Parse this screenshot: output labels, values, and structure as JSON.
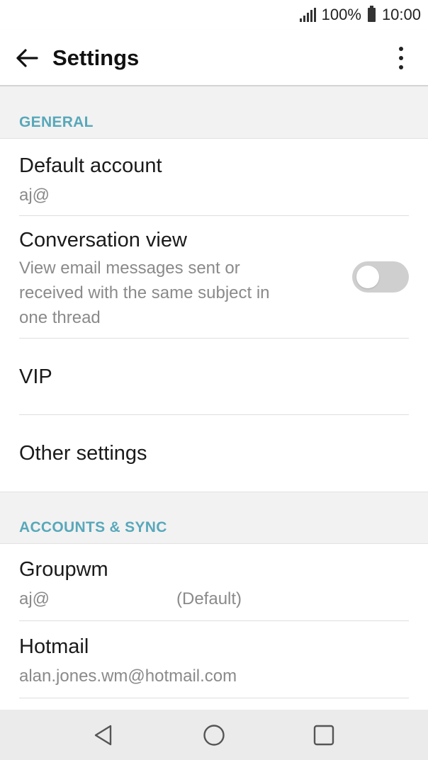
{
  "status_bar": {
    "battery_percent": "100%",
    "time": "10:00"
  },
  "app_bar": {
    "title": "Settings",
    "back_icon": "arrow-left-icon",
    "menu_icon": "more-vertical-icon"
  },
  "general": {
    "header": "GENERAL",
    "default_account": {
      "title": "Default account",
      "value": "aj@"
    },
    "conversation_view": {
      "title": "Conversation view",
      "description_lines": [
        "View email messages sent or",
        "received with the same subject in",
        "one thread"
      ],
      "enabled": false
    },
    "vip": {
      "title": "VIP"
    },
    "other_settings": {
      "title": "Other settings"
    }
  },
  "accounts_sync": {
    "header": "ACCOUNTS & SYNC",
    "accounts": [
      {
        "name": "Groupwm",
        "email": "aj@",
        "tag": "(Default)"
      },
      {
        "name": "Hotmail",
        "email": "alan.jones.wm@hotmail.com",
        "tag": ""
      }
    ]
  },
  "colors": {
    "section_header": "#58a8ba",
    "section_bg": "#f2f2f2",
    "toggle_off": "#cfcfcf",
    "nav_bar": "#ebebeb"
  },
  "nav_bar": {
    "back_icon": "triangle-back-icon",
    "home_icon": "circle-home-icon",
    "recents_icon": "square-recents-icon"
  }
}
